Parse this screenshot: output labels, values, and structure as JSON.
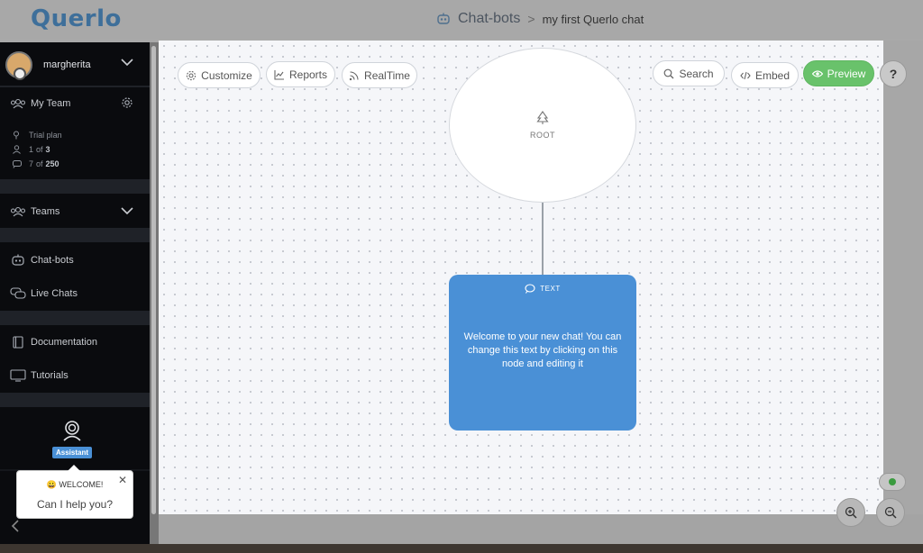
{
  "header": {
    "logo": "Querlo",
    "breadcrumb": {
      "section": "Chat-bots",
      "separator": ">",
      "current": "my first Querlo chat"
    }
  },
  "sidebar": {
    "user": {
      "name": "margherita"
    },
    "my_team": "My Team",
    "plan": {
      "label": "Trial plan",
      "users_used": "1",
      "users_total": "3",
      "chats_used": "7",
      "chats_total": "250",
      "of": "of"
    },
    "teams": "Teams",
    "nav": [
      {
        "label": "Chat-bots",
        "icon": "robot-icon"
      },
      {
        "label": "Live Chats",
        "icon": "chat-bubbles-icon"
      },
      {
        "label": "Documentation",
        "icon": "book-icon"
      },
      {
        "label": "Tutorials",
        "icon": "monitor-icon"
      }
    ]
  },
  "toolbar": {
    "customize": "Customize",
    "reports": "Reports",
    "realtime": "RealTime",
    "search": "Search",
    "embed": "Embed",
    "preview": "Preview",
    "help": "?"
  },
  "nodes": {
    "root_label": "ROOT",
    "text_node": {
      "type_label": "TEXT",
      "body": "Welcome to your new chat! You can change this text by clicking on this node and editing it"
    }
  },
  "assistant": {
    "badge": "Assistant",
    "welcome": "😀 WELCOME!",
    "help_text": "Can I help you?",
    "close": "✕"
  },
  "colors": {
    "accent": "#4a90d6",
    "preview": "#69c26b",
    "sidebar": "#0a0b0e"
  }
}
